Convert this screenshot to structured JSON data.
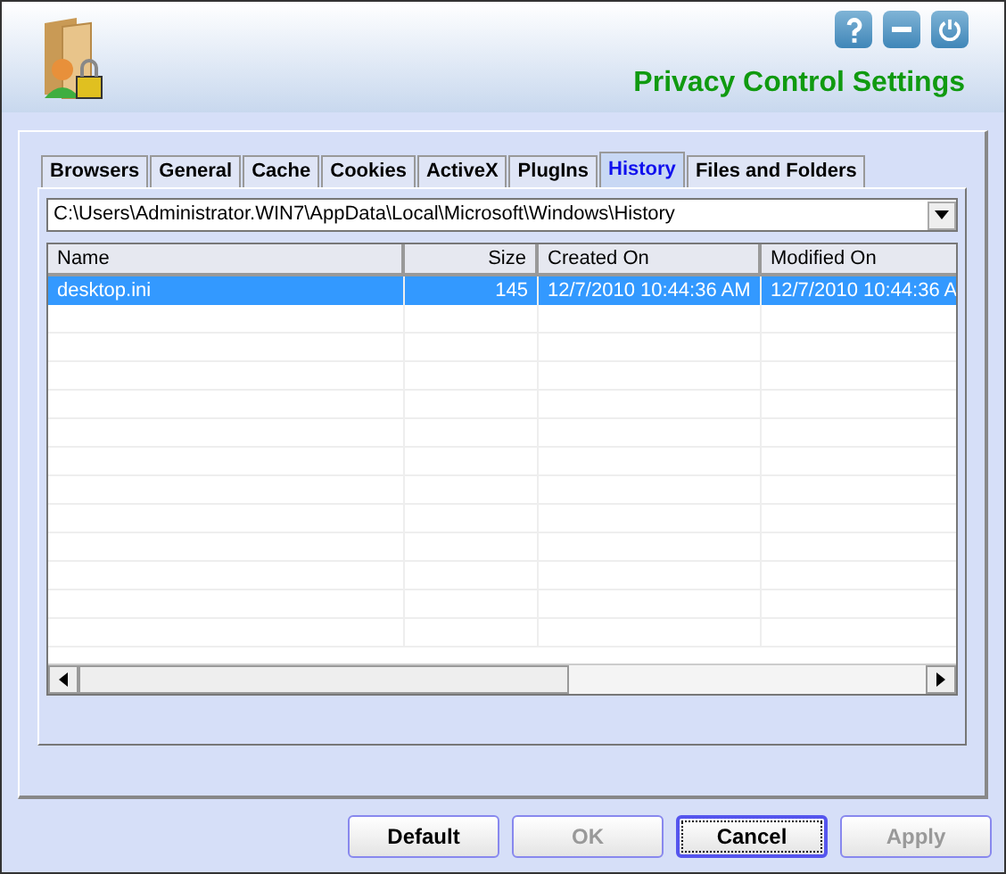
{
  "header": {
    "title": "Privacy Control Settings"
  },
  "tabs": [
    {
      "label": "Browsers",
      "selected": false
    },
    {
      "label": "General",
      "selected": false
    },
    {
      "label": "Cache",
      "selected": false
    },
    {
      "label": "Cookies",
      "selected": false
    },
    {
      "label": "ActiveX",
      "selected": false
    },
    {
      "label": "PlugIns",
      "selected": false
    },
    {
      "label": "History",
      "selected": true
    },
    {
      "label": "Files and Folders",
      "selected": false
    }
  ],
  "path_combo": {
    "value": "C:\\Users\\Administrator.WIN7\\AppData\\Local\\Microsoft\\Windows\\History"
  },
  "table": {
    "columns": [
      {
        "label": "Name"
      },
      {
        "label": "Size"
      },
      {
        "label": "Created On"
      },
      {
        "label": "Modified On"
      }
    ],
    "rows": [
      {
        "cells": [
          "desktop.ini",
          "145",
          "12/7/2010 10:44:36 AM",
          "12/7/2010 10:44:36 A"
        ],
        "selected": true
      }
    ]
  },
  "buttons": [
    {
      "label": "Default",
      "disabled": false,
      "focused": false
    },
    {
      "label": "OK",
      "disabled": true,
      "focused": false
    },
    {
      "label": "Cancel",
      "disabled": false,
      "focused": true
    },
    {
      "label": "Apply",
      "disabled": true,
      "focused": false
    }
  ]
}
